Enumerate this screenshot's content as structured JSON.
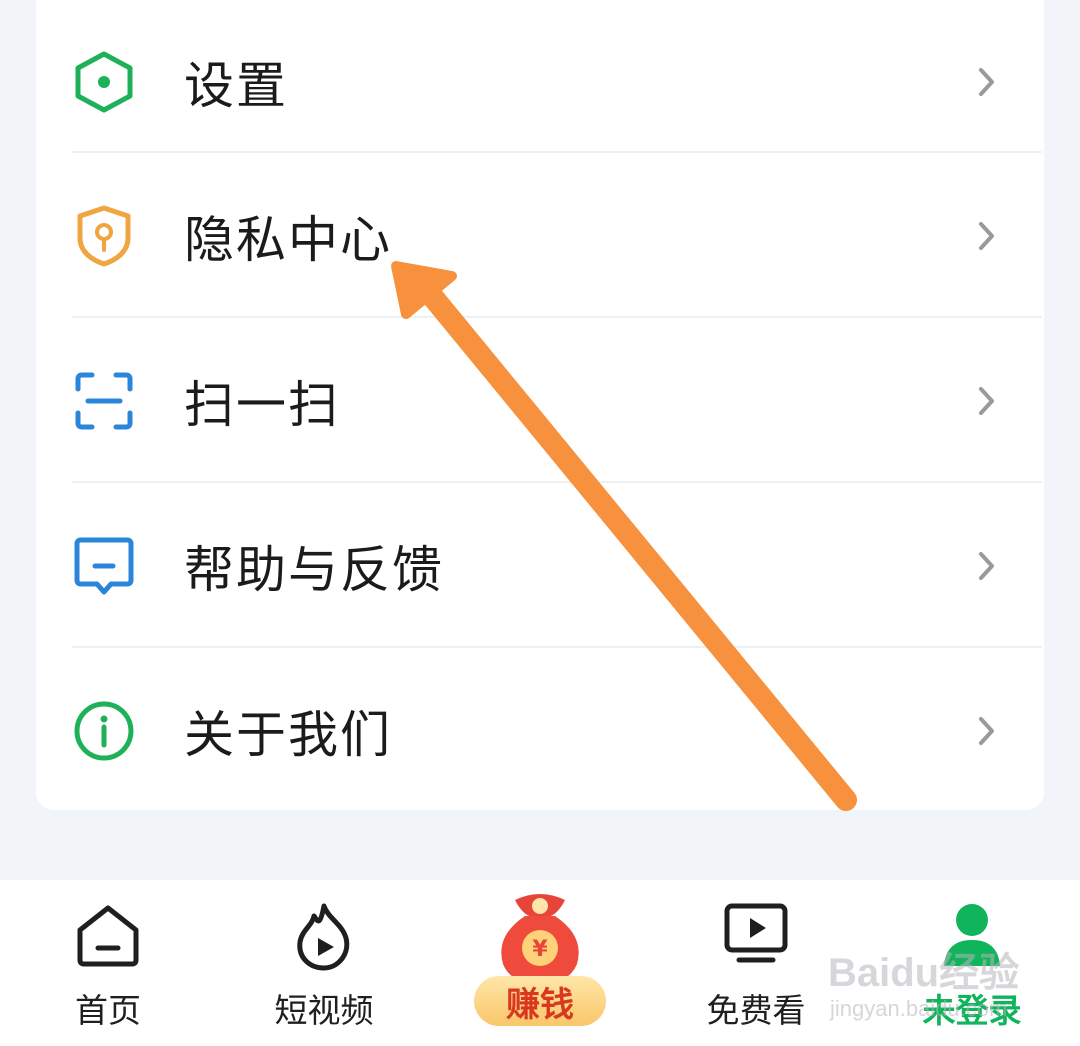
{
  "menu": {
    "items": [
      {
        "label": "设置",
        "icon": "settings-hexagon-icon",
        "color": "#1fb05a"
      },
      {
        "label": "隐私中心",
        "icon": "privacy-shield-icon",
        "color": "#f0a640"
      },
      {
        "label": "扫一扫",
        "icon": "scan-icon",
        "color": "#2a86d8"
      },
      {
        "label": "帮助与反馈",
        "icon": "feedback-icon",
        "color": "#2a86d8"
      },
      {
        "label": "关于我们",
        "icon": "info-icon",
        "color": "#1fb05a"
      }
    ]
  },
  "tabbar": {
    "items": [
      {
        "label": "首页",
        "icon": "home-icon"
      },
      {
        "label": "短视频",
        "icon": "flame-play-icon"
      },
      {
        "label": "赚钱",
        "icon": "money-bag-icon"
      },
      {
        "label": "免费看",
        "icon": "tv-play-icon"
      },
      {
        "label": "未登录",
        "icon": "user-icon",
        "active": true
      }
    ]
  },
  "annotation": {
    "color": "#f7913d"
  },
  "watermark": {
    "text": "Baidu经验",
    "sub": "jingyan.baidu.com"
  }
}
